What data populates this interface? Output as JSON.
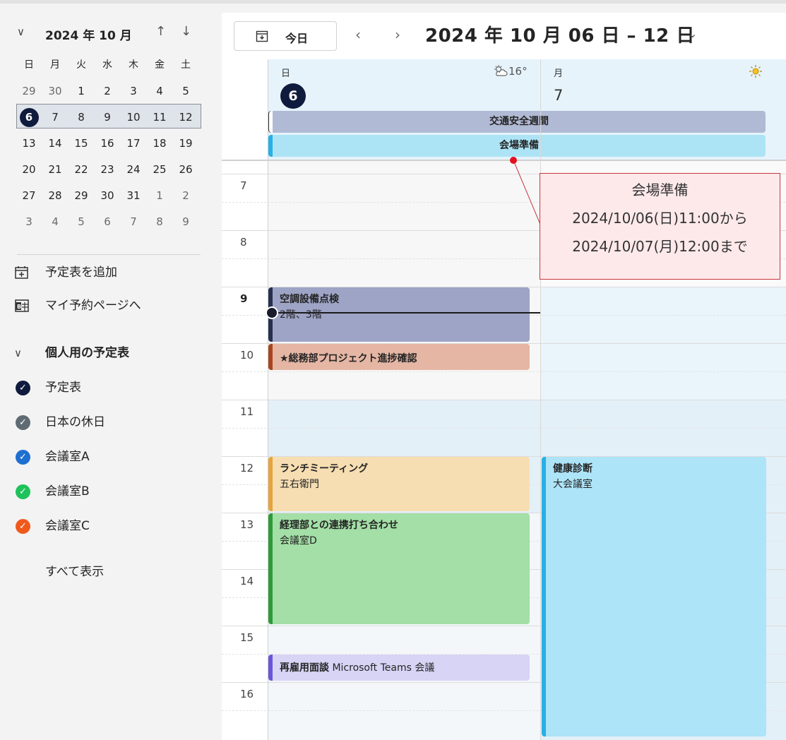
{
  "sidebar": {
    "mini_cal": {
      "title": "2024 年 10 月",
      "weekdays": [
        "日",
        "月",
        "火",
        "水",
        "木",
        "金",
        "土"
      ],
      "weeks": [
        [
          "29",
          "30",
          "1",
          "2",
          "3",
          "4",
          "5"
        ],
        [
          "6",
          "7",
          "8",
          "9",
          "10",
          "11",
          "12"
        ],
        [
          "13",
          "14",
          "15",
          "16",
          "17",
          "18",
          "19"
        ],
        [
          "20",
          "21",
          "22",
          "23",
          "24",
          "25",
          "26"
        ],
        [
          "27",
          "28",
          "29",
          "30",
          "31",
          "1",
          "2"
        ],
        [
          "3",
          "4",
          "5",
          "6",
          "7",
          "8",
          "9"
        ]
      ],
      "today": "6"
    },
    "add_calendar": "予定表を追加",
    "booking_page": "マイ予約ページへ",
    "group_title": "個人用の予定表",
    "calendars": [
      {
        "label": "予定表",
        "color": "#0f1b3d"
      },
      {
        "label": "日本の休日",
        "color": "#5f6b73"
      },
      {
        "label": "会議室A",
        "color": "#1f6fd1"
      },
      {
        "label": "会議室B",
        "color": "#1ec25a"
      },
      {
        "label": "会議室C",
        "color": "#ef5a1c"
      }
    ],
    "show_all": "すべて表示"
  },
  "toolbar": {
    "today": "今日",
    "prev": "‹",
    "next": "›",
    "range": "2024 年 10 月 06 日 – 12 日",
    "range_chevron": "⌄"
  },
  "days": [
    {
      "dow": "日",
      "date": "6",
      "weather": "16°"
    },
    {
      "dow": "月",
      "date": "7",
      "weather": ""
    }
  ],
  "allday_events": [
    {
      "title": "交通安全週間",
      "color": "#b1bad4"
    },
    {
      "title": "会場準備",
      "color": "#ade4f5"
    }
  ],
  "hours": [
    "7",
    "8",
    "9",
    "10",
    "11",
    "12",
    "13",
    "14",
    "15",
    "16"
  ],
  "events": [
    {
      "title": "空調設備点検",
      "sub": "2階、3階",
      "bg": "#9ea4c6",
      "bar": "#27304f"
    },
    {
      "title": "★総務部プロジェクト進捗確認",
      "sub": "",
      "bg": "#e5b6a4",
      "bar": "#a84521"
    },
    {
      "title": "ランチミーティング",
      "sub": "五右衛門",
      "bg": "#f6deb2",
      "bar": "#e5a43d"
    },
    {
      "title": "経理部との連携打ち合わせ",
      "sub": "会議室D",
      "bg": "#a3dfa6",
      "bar": "#2f9a3a"
    },
    {
      "title": "再雇用面談",
      "sub": "Microsoft Teams 会議",
      "bg": "#d8d4f5",
      "bar": "#6856d6"
    },
    {
      "title": "健康診断",
      "sub": "大会議室",
      "bg": "#ade4f8",
      "bar": "#27b0e6"
    }
  ],
  "callout": {
    "title": "会場準備",
    "start": "2024/10/06(日)11:00から",
    "end": "2024/10/07(月)12:00まで"
  }
}
